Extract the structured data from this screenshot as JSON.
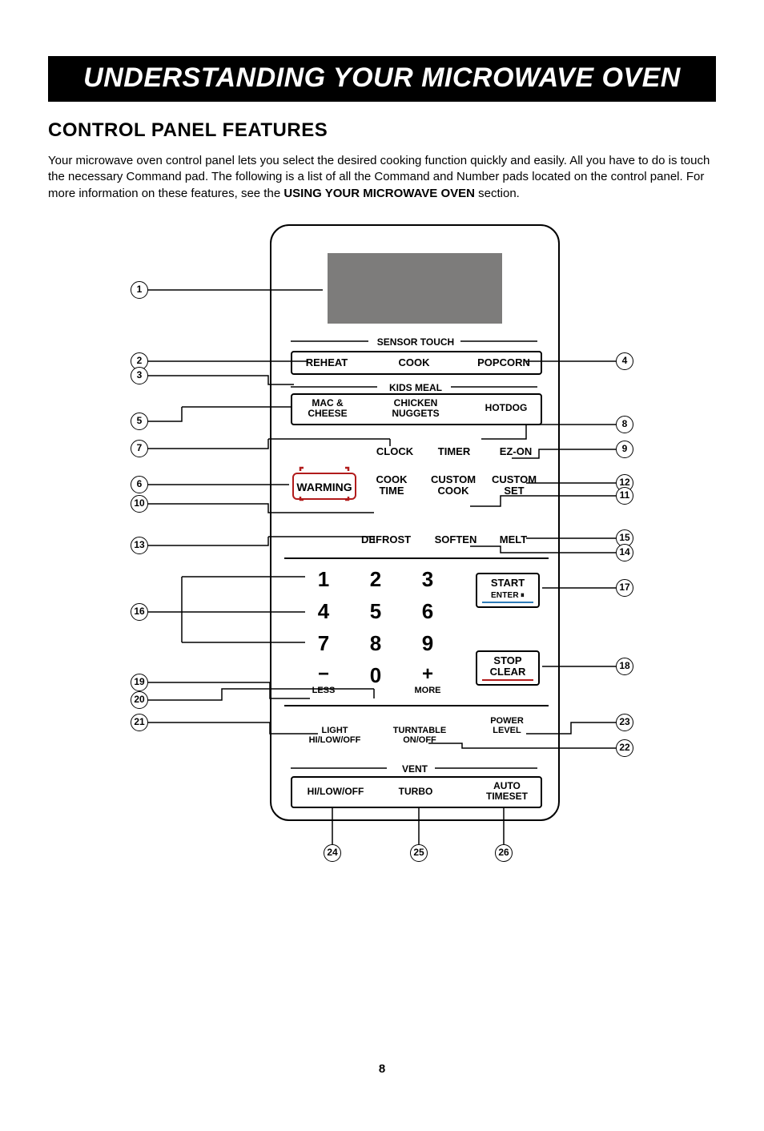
{
  "title_bar": "UNDERSTANDING YOUR MICROWAVE OVEN",
  "section_heading": "CONTROL PANEL FEATURES",
  "intro_part1": "Your microwave oven control panel lets you select the desired cooking function quickly and easily. All you have to do is touch the necessary Command pad. The following is a list of all the Command and Number pads located on the control panel. For more information on these features, see the ",
  "intro_strong": "USING YOUR MICROWAVE OVEN",
  "intro_part2": " section.",
  "page_number": "8",
  "panel": {
    "sensor_touch": "SENSOR TOUCH",
    "reheat": "REHEAT",
    "cook": "COOK",
    "popcorn": "POPCORN",
    "kids_meal": "KIDS MEAL",
    "mac_cheese": "MAC &\nCHEESE",
    "chicken_nuggets": "CHICKEN\nNUGGETS",
    "hotdog": "HOTDOG",
    "clock": "CLOCK",
    "timer": "TIMER",
    "ezon": "EZ-ON",
    "warming": "WARMING",
    "cook_time": "COOK\nTIME",
    "custom_cook": "CUSTOM\nCOOK",
    "custom_set": "CUSTOM\nSET",
    "defrost": "DEFROST",
    "soften": "SOFTEN",
    "melt": "MELT",
    "start": "START",
    "enter": "ENTER",
    "stop": "STOP",
    "clear": "CLEAR",
    "less": "LESS",
    "more": "MORE",
    "light": "LIGHT",
    "light_sub": "HI/LOW/OFF",
    "turntable": "TURNTABLE",
    "turntable_sub": "ON/OFF",
    "power_level": "POWER\nLEVEL",
    "vent": "VENT",
    "vent_hi": "HI/LOW/OFF",
    "turbo": "TURBO",
    "auto_timeset": "AUTO\nTIMESET",
    "minus": "−",
    "plus": "+",
    "n1": "1",
    "n2": "2",
    "n3": "3",
    "n4": "4",
    "n5": "5",
    "n6": "6",
    "n7": "7",
    "n8": "8",
    "n9": "9",
    "n0": "0"
  },
  "callouts": {
    "c1": "1",
    "c2": "2",
    "c3": "3",
    "c4": "4",
    "c5": "5",
    "c6": "6",
    "c7": "7",
    "c8": "8",
    "c9": "9",
    "c10": "10",
    "c11": "11",
    "c12": "12",
    "c13": "13",
    "c14": "14",
    "c15": "15",
    "c16": "16",
    "c17": "17",
    "c18": "18",
    "c19": "19",
    "c20": "20",
    "c21": "21",
    "c22": "22",
    "c23": "23",
    "c24": "24",
    "c25": "25",
    "c26": "26"
  }
}
